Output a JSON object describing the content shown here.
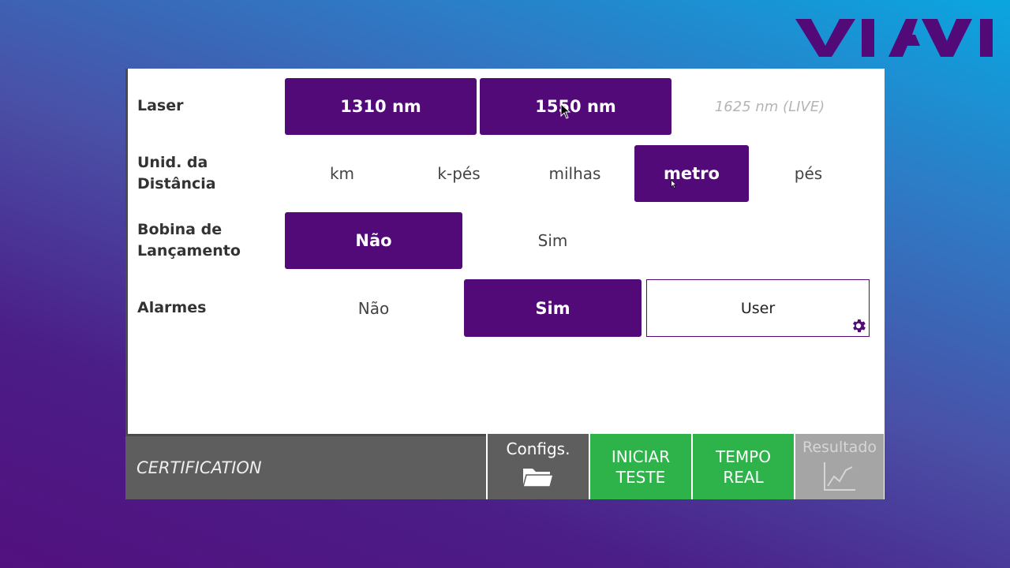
{
  "brand": {
    "logo_text": "VIAVI",
    "logo_color": "#510a78"
  },
  "rows": {
    "laser": {
      "label": "Laser",
      "options": [
        "1310 nm",
        "1550 nm",
        "1625 nm (LIVE)"
      ]
    },
    "distance": {
      "label_line1": "Unid. da",
      "label_line2": "Distância",
      "options": [
        "km",
        "k-pés",
        "milhas",
        "metro",
        "pés"
      ],
      "selected": "metro"
    },
    "launch": {
      "label_line1": "Bobina de",
      "label_line2": "Lançamento",
      "options": [
        "Não",
        "Sim"
      ],
      "selected": "Não"
    },
    "alarms": {
      "label": "Alarmes",
      "options": [
        "Não",
        "Sim",
        "User"
      ],
      "selected": "Sim"
    }
  },
  "bottom_bar": {
    "mode": "CERTIFICATION",
    "configs": "Configs.",
    "start_line1": "INICIAR",
    "start_line2": "TESTE",
    "realtime_line1": "TEMPO",
    "realtime_line2": "REAL",
    "results": "Resultado"
  },
  "colors": {
    "accent": "#510a78",
    "green": "#2db34a",
    "bar_gray": "#5e5e5e",
    "disabled": "#a5a5a5"
  },
  "icons": [
    "folder-icon",
    "chart-icon",
    "gear-icon",
    "mouse-cursor-icon"
  ]
}
